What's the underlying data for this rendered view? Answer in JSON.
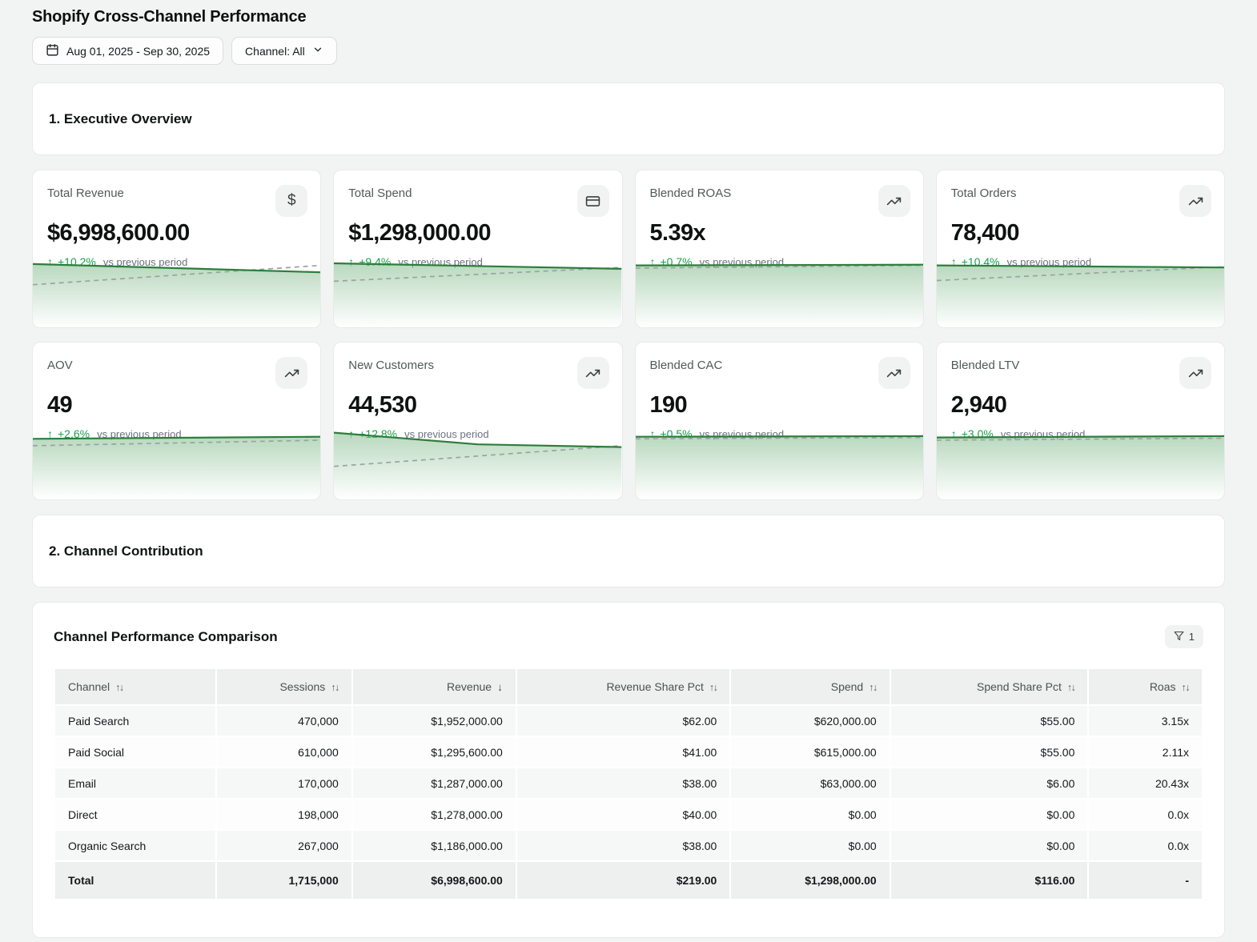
{
  "page": {
    "title": "Shopify Cross-Channel Performance"
  },
  "toolbar": {
    "date_range": "Aug 01, 2025 - Sep 30, 2025",
    "channel_filter": "Channel: All"
  },
  "sections": {
    "overview": "1. Executive Overview",
    "contribution": "2. Channel Contribution"
  },
  "icons": {
    "arrow_up": "↑",
    "dollar": "$",
    "sort_both": "↑↓",
    "sort_desc": "↓"
  },
  "colors": {
    "accent_green": "#16a34a",
    "spark_line": "#2d7d3c",
    "spark_dashed": "#9aa3a0",
    "spark_fill": "#7fb98a"
  },
  "kpis": [
    {
      "label": "Total Revenue",
      "value": "$6,998,600.00",
      "delta": "+10.2%",
      "delta_note": "vs previous period",
      "icon": "dollar-icon",
      "spark": {
        "solid": [
          [
            0,
            0.08
          ],
          [
            1,
            0.2
          ]
        ],
        "dashed": [
          [
            0,
            0.38
          ],
          [
            1,
            0.1
          ]
        ]
      }
    },
    {
      "label": "Total Spend",
      "value": "$1,298,000.00",
      "delta": "+9.4%",
      "delta_note": "vs previous period",
      "icon": "credit-card-icon",
      "spark": {
        "solid": [
          [
            0,
            0.07
          ],
          [
            1,
            0.15
          ]
        ],
        "dashed": [
          [
            0,
            0.33
          ],
          [
            1,
            0.13
          ]
        ]
      }
    },
    {
      "label": "Blended ROAS",
      "value": "5.39x",
      "delta": "+0.7%",
      "delta_note": "vs previous period",
      "icon": "trending-up-icon",
      "spark": {
        "solid": [
          [
            0,
            0.1
          ],
          [
            1,
            0.09
          ]
        ],
        "dashed": [
          [
            0,
            0.14
          ],
          [
            1,
            0.1
          ]
        ]
      }
    },
    {
      "label": "Total Orders",
      "value": "78,400",
      "delta": "+10.4%",
      "delta_note": "vs previous period",
      "icon": "trending-up-icon",
      "spark": {
        "solid": [
          [
            0,
            0.1
          ],
          [
            1,
            0.13
          ]
        ],
        "dashed": [
          [
            0,
            0.32
          ],
          [
            1,
            0.12
          ]
        ]
      }
    },
    {
      "label": "AOV",
      "value": "49",
      "delta": "+2.6%",
      "delta_note": "vs previous period",
      "icon": "trending-up-icon",
      "spark": {
        "solid": [
          [
            0,
            0.12
          ],
          [
            1,
            0.09
          ]
        ],
        "dashed": [
          [
            0,
            0.22
          ],
          [
            1,
            0.14
          ]
        ]
      }
    },
    {
      "label": "New Customers",
      "value": "44,530",
      "delta": "+12.8%",
      "delta_note": "vs previous period",
      "icon": "trending-up-icon",
      "spark": {
        "solid": [
          [
            0,
            0.03
          ],
          [
            0.5,
            0.2
          ],
          [
            1,
            0.24
          ]
        ],
        "dashed": [
          [
            0,
            0.52
          ],
          [
            1,
            0.22
          ]
        ]
      }
    },
    {
      "label": "Blended CAC",
      "value": "190",
      "delta": "+0.5%",
      "delta_note": "vs previous period",
      "icon": "trending-up-icon",
      "spark": {
        "solid": [
          [
            0,
            0.09
          ],
          [
            1,
            0.08
          ]
        ],
        "dashed": [
          [
            0,
            0.12
          ],
          [
            1,
            0.1
          ]
        ]
      }
    },
    {
      "label": "Blended LTV",
      "value": "2,940",
      "delta": "+3.0%",
      "delta_note": "vs previous period",
      "icon": "trending-up-icon",
      "spark": {
        "solid": [
          [
            0,
            0.1
          ],
          [
            1,
            0.08
          ]
        ],
        "dashed": [
          [
            0,
            0.14
          ],
          [
            1,
            0.11
          ]
        ]
      }
    }
  ],
  "table": {
    "title": "Channel Performance Comparison",
    "filter_count": "1",
    "columns": [
      {
        "label": "Channel",
        "sort": "both"
      },
      {
        "label": "Sessions",
        "sort": "both"
      },
      {
        "label": "Revenue",
        "sort": "desc"
      },
      {
        "label": "Revenue Share Pct",
        "sort": "both"
      },
      {
        "label": "Spend",
        "sort": "both"
      },
      {
        "label": "Spend Share Pct",
        "sort": "both"
      },
      {
        "label": "Roas",
        "sort": "both"
      }
    ],
    "rows": [
      [
        "Paid Search",
        "470,000",
        "$1,952,000.00",
        "$62.00",
        "$620,000.00",
        "$55.00",
        "3.15x"
      ],
      [
        "Paid Social",
        "610,000",
        "$1,295,600.00",
        "$41.00",
        "$615,000.00",
        "$55.00",
        "2.11x"
      ],
      [
        "Email",
        "170,000",
        "$1,287,000.00",
        "$38.00",
        "$63,000.00",
        "$6.00",
        "20.43x"
      ],
      [
        "Direct",
        "198,000",
        "$1,278,000.00",
        "$40.00",
        "$0.00",
        "$0.00",
        "0.0x"
      ],
      [
        "Organic Search",
        "267,000",
        "$1,186,000.00",
        "$38.00",
        "$0.00",
        "$0.00",
        "0.0x"
      ]
    ],
    "total": [
      "Total",
      "1,715,000",
      "$6,998,600.00",
      "$219.00",
      "$1,298,000.00",
      "$116.00",
      "-"
    ]
  }
}
